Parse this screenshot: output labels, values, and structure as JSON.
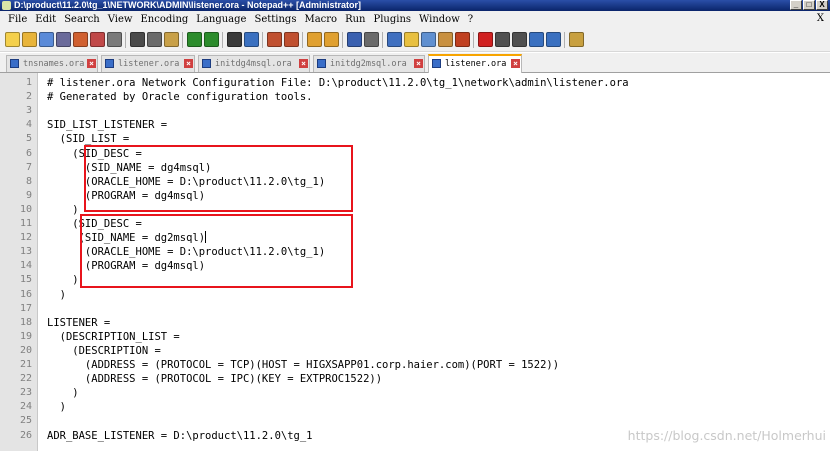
{
  "window": {
    "title": "D:\\product\\11.2.0\\tg_1\\NETWORK\\ADMIN\\listener.ora - Notepad++ [Administrator]",
    "controls": [
      "_",
      "□",
      "X"
    ]
  },
  "menu": {
    "items": [
      "File",
      "Edit",
      "Search",
      "View",
      "Encoding",
      "Language",
      "Settings",
      "Macro",
      "Run",
      "Plugins",
      "Window",
      "?"
    ],
    "close_label": "X"
  },
  "tabs": [
    {
      "label": "tnsnames.ora",
      "active": false
    },
    {
      "label": "listener.ora",
      "active": false
    },
    {
      "label": "initdg4msql.ora",
      "active": false
    },
    {
      "label": "initdg2msql.ora",
      "active": false
    },
    {
      "label": "listener.ora",
      "active": true
    }
  ],
  "editor": {
    "lines": [
      {
        "n": "1",
        "text": "# listener.ora Network Configuration File: D:\\product\\11.2.0\\tg_1\\network\\admin\\listener.ora"
      },
      {
        "n": "2",
        "text": "# Generated by Oracle configuration tools."
      },
      {
        "n": "3",
        "text": ""
      },
      {
        "n": "4",
        "text": "SID_LIST_LISTENER ="
      },
      {
        "n": "5",
        "text": "  (SID_LIST ="
      },
      {
        "n": "6",
        "text": "    (SID_DESC ="
      },
      {
        "n": "7",
        "text": "      (SID_NAME = dg4msql)"
      },
      {
        "n": "8",
        "text": "      (ORACLE_HOME = D:\\product\\11.2.0\\tg_1)"
      },
      {
        "n": "9",
        "text": "      (PROGRAM = dg4msql)"
      },
      {
        "n": "10",
        "text": "    )"
      },
      {
        "n": "11",
        "text": "    (SID_DESC ="
      },
      {
        "n": "12",
        "text": "     (SID_NAME = dg2msql)"
      },
      {
        "n": "13",
        "text": "      (ORACLE_HOME = D:\\product\\11.2.0\\tg_1)"
      },
      {
        "n": "14",
        "text": "      (PROGRAM = dg4msql)"
      },
      {
        "n": "15",
        "text": "    )"
      },
      {
        "n": "16",
        "text": "  )"
      },
      {
        "n": "17",
        "text": ""
      },
      {
        "n": "18",
        "text": "LISTENER ="
      },
      {
        "n": "19",
        "text": "  (DESCRIPTION_LIST ="
      },
      {
        "n": "20",
        "text": "    (DESCRIPTION ="
      },
      {
        "n": "21",
        "text": "      (ADDRESS = (PROTOCOL = TCP)(HOST = HIGXSAPP01.corp.haier.com)(PORT = 1522))"
      },
      {
        "n": "22",
        "text": "      (ADDRESS = (PROTOCOL = IPC)(KEY = EXTPROC1522))"
      },
      {
        "n": "23",
        "text": "    )"
      },
      {
        "n": "24",
        "text": "  )"
      },
      {
        "n": "25",
        "text": ""
      },
      {
        "n": "26",
        "text": "ADR_BASE_LISTENER = D:\\product\\11.2.0\\tg_1"
      }
    ]
  },
  "watermark": "https://blog.csdn.net/Holmerhui",
  "colors": {
    "title_bar": "#0a246a",
    "annotation_box": "#e8141c",
    "active_tab_accent": "#f7a400"
  },
  "toolbar_icons": [
    "new-file-icon",
    "open-file-icon",
    "save-icon",
    "save-all-icon",
    "close-icon",
    "close-all-icon",
    "print-icon",
    "cut-icon",
    "copy-icon",
    "paste-icon",
    "undo-icon",
    "redo-icon",
    "find-icon",
    "replace-icon",
    "zoom-in-icon",
    "zoom-out-icon",
    "sync-vertical-icon",
    "sync-horizontal-icon",
    "word-wrap-icon",
    "show-all-chars-icon",
    "indent-guide-icon",
    "user-language-icon",
    "doc-map-icon",
    "function-list-icon",
    "folder-workspace-icon",
    "record-macro-icon",
    "stop-macro-icon",
    "play-macro-icon",
    "play-multiple-icon",
    "save-macro-icon",
    "misc-icon"
  ]
}
